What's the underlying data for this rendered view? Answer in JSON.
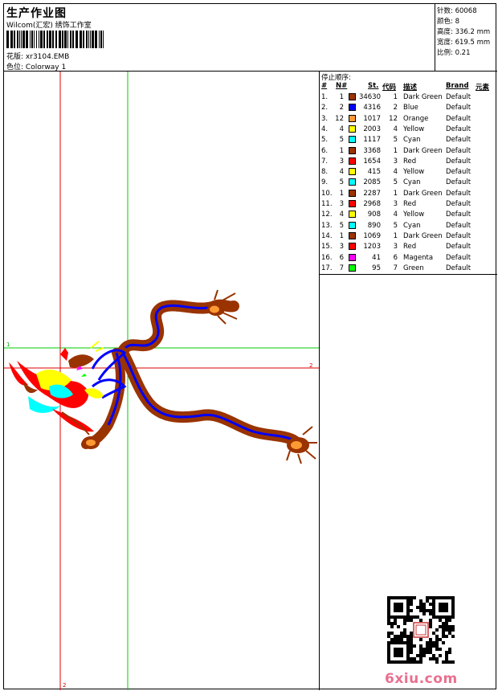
{
  "header": {
    "title": "生产作业图",
    "company": "Wilcom(汇宏) 绣饰工作室",
    "design_label": "花版:",
    "design_value": "xr3104.EMB",
    "colorway_label": "色位:",
    "colorway_value": "Colorway 1"
  },
  "stats": {
    "stitches": "针数: 60068",
    "colors": "颜色: 8",
    "height": "高度: 336.2 mm",
    "width": "宽度: 619.5 mm",
    "scale": "比例: 0.21"
  },
  "sequence": {
    "title": "停止顺序:",
    "headers": {
      "num": "#",
      "n": "N#",
      "st": "St.",
      "code": "代码",
      "desc": "描述",
      "brand": "Brand",
      "element": "元素"
    },
    "rows": [
      {
        "num": "1.",
        "n": "1",
        "st": "34630",
        "code": "1",
        "desc": "Dark Green",
        "brand": "Default",
        "color": "#993300"
      },
      {
        "num": "2.",
        "n": "2",
        "st": "4316",
        "code": "2",
        "desc": "Blue",
        "brand": "Default",
        "color": "#0000ff"
      },
      {
        "num": "3.",
        "n": "12",
        "st": "1017",
        "code": "12",
        "desc": "Orange",
        "brand": "Default",
        "color": "#ff9933"
      },
      {
        "num": "4.",
        "n": "4",
        "st": "2003",
        "code": "4",
        "desc": "Yellow",
        "brand": "Default",
        "color": "#ffff00"
      },
      {
        "num": "5.",
        "n": "5",
        "st": "1117",
        "code": "5",
        "desc": "Cyan",
        "brand": "Default",
        "color": "#00ffff"
      },
      {
        "num": "6.",
        "n": "1",
        "st": "3368",
        "code": "1",
        "desc": "Dark Green",
        "brand": "Default",
        "color": "#993300"
      },
      {
        "num": "7.",
        "n": "3",
        "st": "1654",
        "code": "3",
        "desc": "Red",
        "brand": "Default",
        "color": "#ff0000"
      },
      {
        "num": "8.",
        "n": "4",
        "st": "415",
        "code": "4",
        "desc": "Yellow",
        "brand": "Default",
        "color": "#ffff00"
      },
      {
        "num": "9.",
        "n": "5",
        "st": "2085",
        "code": "5",
        "desc": "Cyan",
        "brand": "Default",
        "color": "#00ffff"
      },
      {
        "num": "10.",
        "n": "1",
        "st": "2287",
        "code": "1",
        "desc": "Dark Green",
        "brand": "Default",
        "color": "#993300"
      },
      {
        "num": "11.",
        "n": "3",
        "st": "2968",
        "code": "3",
        "desc": "Red",
        "brand": "Default",
        "color": "#ff0000"
      },
      {
        "num": "12.",
        "n": "4",
        "st": "908",
        "code": "4",
        "desc": "Yellow",
        "brand": "Default",
        "color": "#ffff00"
      },
      {
        "num": "13.",
        "n": "5",
        "st": "890",
        "code": "5",
        "desc": "Cyan",
        "brand": "Default",
        "color": "#00ffff"
      },
      {
        "num": "14.",
        "n": "1",
        "st": "1069",
        "code": "1",
        "desc": "Dark Green",
        "brand": "Default",
        "color": "#993300"
      },
      {
        "num": "15.",
        "n": "3",
        "st": "1203",
        "code": "3",
        "desc": "Red",
        "brand": "Default",
        "color": "#ff0000"
      },
      {
        "num": "16.",
        "n": "6",
        "st": "41",
        "code": "6",
        "desc": "Magenta",
        "brand": "Default",
        "color": "#ff00ff"
      },
      {
        "num": "17.",
        "n": "7",
        "st": "95",
        "code": "7",
        "desc": "Green",
        "brand": "Default",
        "color": "#00ff00"
      }
    ]
  },
  "canvas": {
    "guide_labels": {
      "green_h": "1",
      "red_h": "2",
      "red_v": "2"
    }
  },
  "footer": {
    "site": "6xiu.com"
  }
}
